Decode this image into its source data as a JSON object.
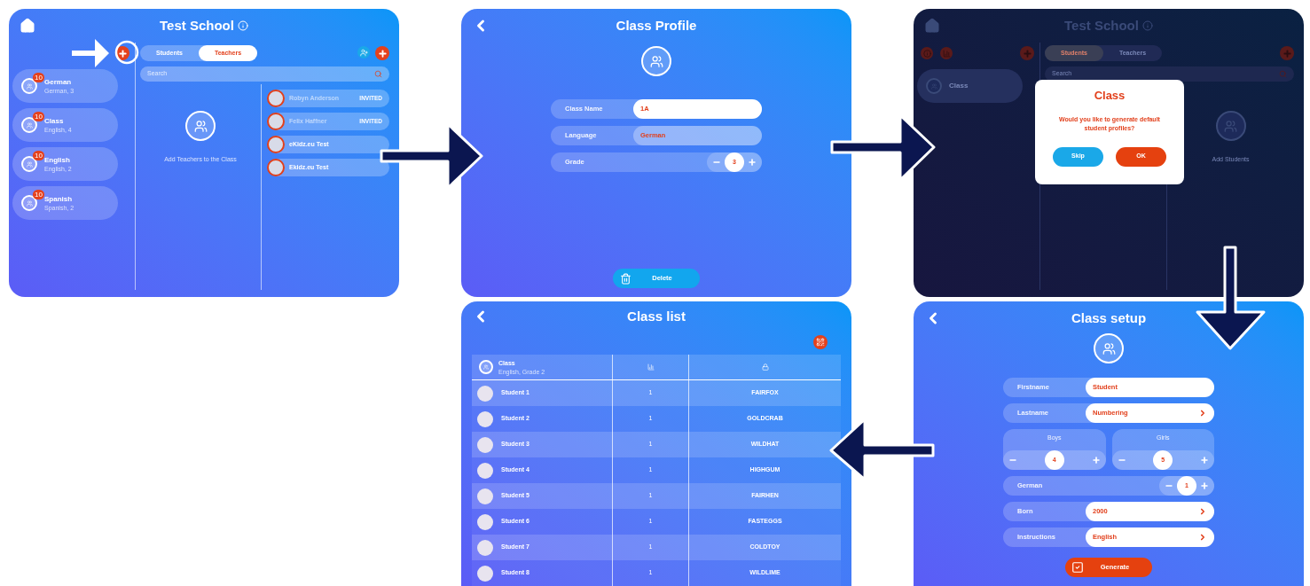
{
  "school_screen": {
    "title": "Test School",
    "tabs": [
      {
        "label": "Students",
        "selected": false
      },
      {
        "label": "Teachers",
        "selected": true
      }
    ],
    "search": {
      "placeholder": "Search"
    },
    "classes": [
      {
        "name": "German",
        "detail": "German, 3",
        "badge": "10"
      },
      {
        "name": "Class",
        "detail": "English, 4",
        "badge": "10"
      },
      {
        "name": "English",
        "detail": "English, 2",
        "badge": "10"
      },
      {
        "name": "Spanish",
        "detail": "Spanish, 2",
        "badge": "10"
      }
    ],
    "empty_hint": "Add Teachers to the Class",
    "teachers": [
      {
        "name": "Robyn Anderson",
        "status": "INVITED",
        "invited": true
      },
      {
        "name": "Felix Haffner",
        "status": "INVITED",
        "invited": true
      },
      {
        "name": "eKidz.eu Test",
        "invited": false
      },
      {
        "name": "Ekidz.eu Test",
        "invited": false
      }
    ]
  },
  "class_profile": {
    "title": "Class Profile",
    "fields": [
      {
        "kind": "text",
        "label": "Class Name",
        "value": "1A"
      },
      {
        "kind": "readonly",
        "label": "Language",
        "value": "German"
      },
      {
        "kind": "stepper",
        "label": "Grade",
        "value": "3"
      }
    ],
    "delete_button": "Delete"
  },
  "dialog_screen": {
    "title": "Test School",
    "tabs": [
      {
        "label": "Students",
        "selected": true
      },
      {
        "label": "Teachers",
        "selected": false
      }
    ],
    "search": {
      "placeholder": "Search"
    },
    "classes": [
      {
        "name": "Class"
      }
    ],
    "empty_hint": "Add Students",
    "dialog": {
      "title": "Class",
      "message": "Would you like to generate default student profiles?",
      "buttons": [
        {
          "label": "Skip",
          "kind": "secondary"
        },
        {
          "label": "OK",
          "kind": "primary"
        }
      ]
    }
  },
  "class_setup": {
    "title": "Class setup",
    "fields": [
      {
        "kind": "text",
        "label": "Firstname",
        "value": "Student"
      },
      {
        "kind": "select",
        "label": "Lastname",
        "value": "Numbering"
      },
      {
        "kind": "counters",
        "items": [
          {
            "label": "Boys",
            "value": "4"
          },
          {
            "label": "Girls",
            "value": "5"
          }
        ]
      },
      {
        "kind": "stepper",
        "label": "German",
        "value": "1"
      },
      {
        "kind": "select",
        "label": "Born",
        "value": "2000"
      },
      {
        "kind": "select",
        "label": "Instructions",
        "value": "English"
      }
    ],
    "generate_button": "Generate"
  },
  "class_list": {
    "title": "Class list",
    "class_name": "Class",
    "class_detail": "English, Grade 2",
    "rows": [
      {
        "name": "Student 1",
        "level": "1",
        "password": "FAIRFOX"
      },
      {
        "name": "Student 2",
        "level": "1",
        "password": "GOLDCRAB"
      },
      {
        "name": "Student 3",
        "level": "1",
        "password": "WILDHAT"
      },
      {
        "name": "Student 4",
        "level": "1",
        "password": "HIGHGUM"
      },
      {
        "name": "Student 5",
        "level": "1",
        "password": "FAIRHEN"
      },
      {
        "name": "Student 6",
        "level": "1",
        "password": "FASTEGGS"
      },
      {
        "name": "Student 7",
        "level": "1",
        "password": "COLDTOY"
      },
      {
        "name": "Student 8",
        "level": "1",
        "password": "WILDLIME"
      }
    ]
  }
}
